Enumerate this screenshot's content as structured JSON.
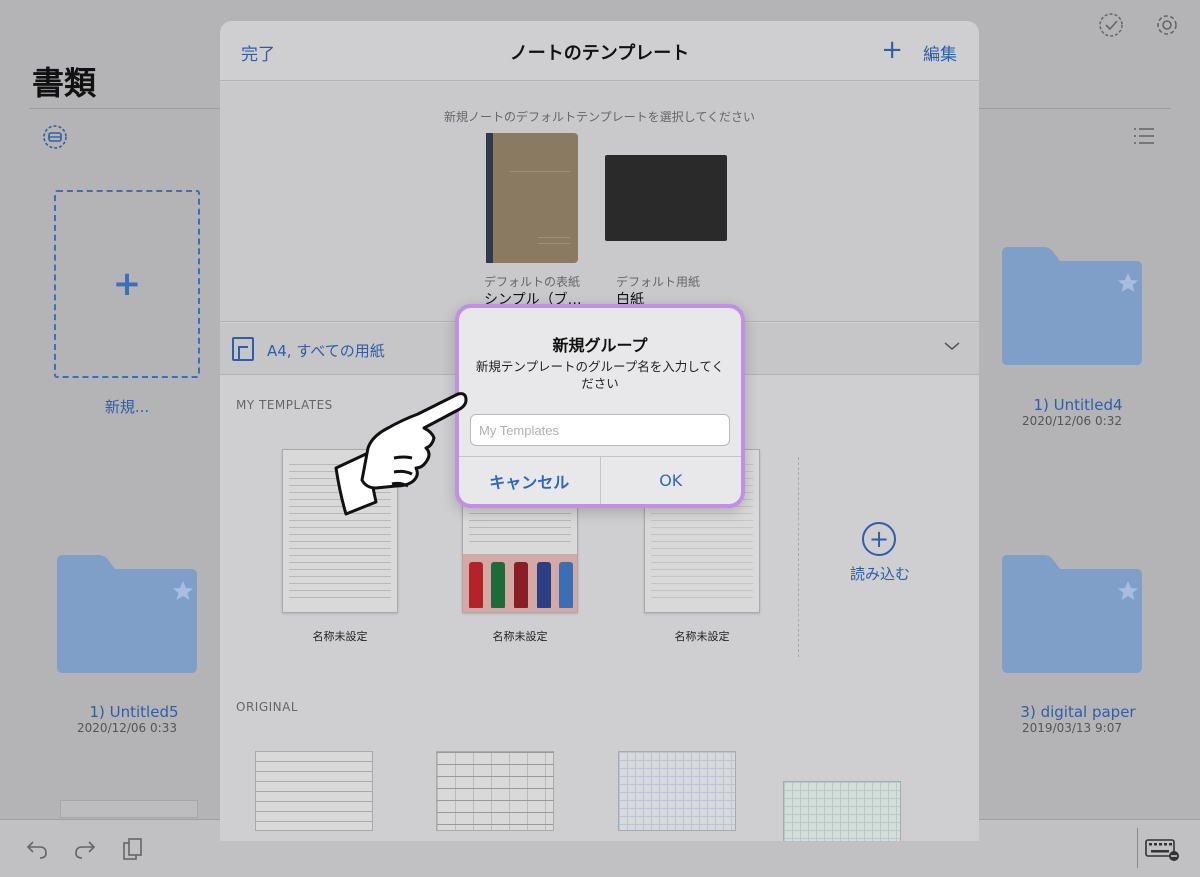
{
  "background": {
    "title": "書類",
    "new_tile_label": "新規...",
    "folders": [
      {
        "name": "1) Untitled4",
        "date": "2020/12/06 0:32"
      },
      {
        "name": "1) Untitled5",
        "date": "2020/12/06 0:33"
      },
      {
        "name": "3) digital paper",
        "date": "2019/03/13 9:07"
      }
    ]
  },
  "sheet": {
    "done_label": "完了",
    "title": "ノートのテンプレート",
    "plus_label": "+",
    "edit_label": "編集",
    "default_hint": "新規ノートのデフォルトテンプレートを選択してください",
    "default_cover_label": "デフォルトの表紙",
    "default_cover_value": "シンプル（ブ…",
    "default_paper_label": "デフォルト用紙",
    "default_paper_value": "白紙",
    "size_label": "A4, すべての用紙",
    "my_templates_title": "MY TEMPLATES",
    "my_templates": [
      {
        "name": "名称未設定"
      },
      {
        "name": "名称未設定"
      },
      {
        "name": "名称未設定"
      }
    ],
    "import_label": "読み込む",
    "original_title": "ORIGINAL"
  },
  "dialog": {
    "title": "新規グループ",
    "message": "新規テンプレートのグループ名を入力してください",
    "input_placeholder": "My Templates",
    "input_value": "",
    "cancel_label": "キャンセル",
    "ok_label": "OK"
  },
  "colors": {
    "accent": "#2e5ea8",
    "dialog_highlight": "#c08fe6",
    "folder": "#7f9ec8"
  }
}
